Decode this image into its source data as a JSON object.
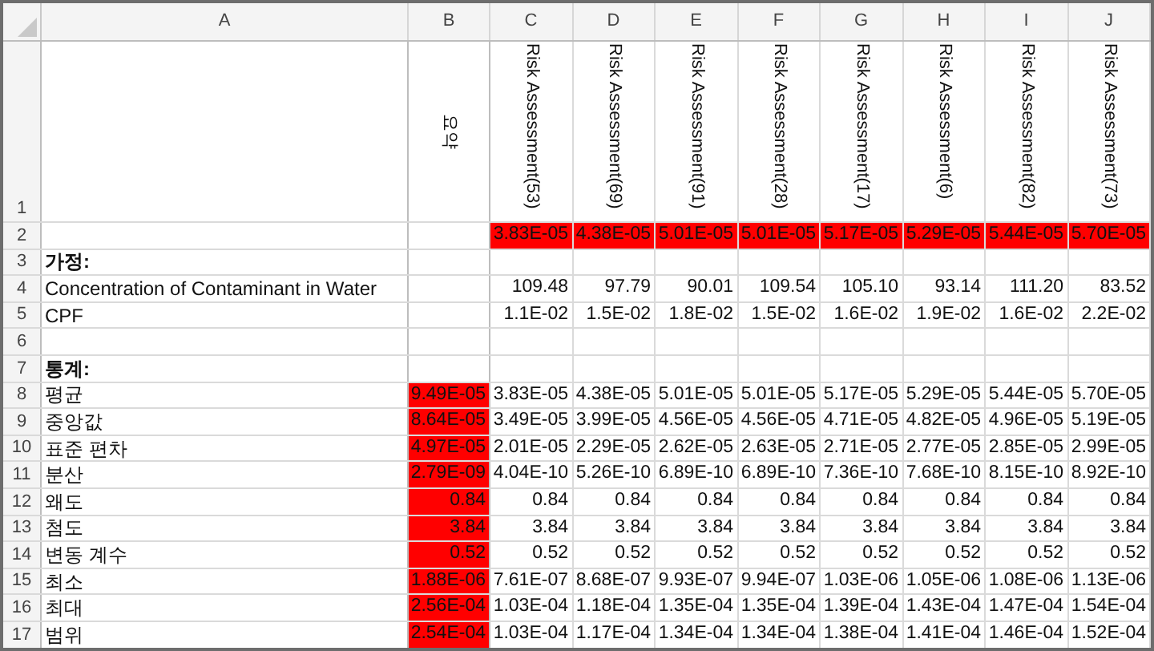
{
  "columns": [
    {
      "letter": "A"
    },
    {
      "letter": "B",
      "header": "요약"
    },
    {
      "letter": "C",
      "header": "Risk Assessment(53)"
    },
    {
      "letter": "D",
      "header": "Risk Assessment(69)"
    },
    {
      "letter": "E",
      "header": "Risk Assessment(91)"
    },
    {
      "letter": "F",
      "header": "Risk Assessment(28)"
    },
    {
      "letter": "G",
      "header": "Risk Assessment(17)"
    },
    {
      "letter": "H",
      "header": "Risk Assessment(6)"
    },
    {
      "letter": "I",
      "header": "Risk Assessment(82)"
    },
    {
      "letter": "J",
      "header": "Risk Assessment(73)"
    }
  ],
  "rows": [
    {
      "number": "1"
    },
    {
      "number": "2",
      "cells": [
        {
          "text": "3.83E-05",
          "highlighted": true
        },
        {
          "text": "4.38E-05",
          "highlighted": true
        },
        {
          "text": "5.01E-05",
          "highlighted": true
        },
        {
          "text": "5.01E-05",
          "highlighted": true
        },
        {
          "text": "5.17E-05",
          "highlighted": true
        },
        {
          "text": "5.29E-05",
          "highlighted": true
        },
        {
          "text": "5.44E-05",
          "highlighted": true
        },
        {
          "text": "5.70E-05",
          "highlighted": true
        }
      ]
    },
    {
      "number": "3",
      "label": "가정:",
      "bold": true
    },
    {
      "number": "4",
      "label": "Concentration of Contaminant in Water",
      "bold": false,
      "cells": [
        {
          "text": "109.48",
          "highlighted": false
        },
        {
          "text": "97.79",
          "highlighted": false
        },
        {
          "text": "90.01",
          "highlighted": false
        },
        {
          "text": "109.54",
          "highlighted": false
        },
        {
          "text": "105.10",
          "highlighted": false
        },
        {
          "text": "93.14",
          "highlighted": false
        },
        {
          "text": "111.20",
          "highlighted": false
        },
        {
          "text": "83.52",
          "highlighted": false
        }
      ]
    },
    {
      "number": "5",
      "label": "CPF",
      "bold": false,
      "cells": [
        {
          "text": "1.1E-02",
          "highlighted": false
        },
        {
          "text": "1.5E-02",
          "highlighted": false
        },
        {
          "text": "1.8E-02",
          "highlighted": false
        },
        {
          "text": "1.5E-02",
          "highlighted": false
        },
        {
          "text": "1.6E-02",
          "highlighted": false
        },
        {
          "text": "1.9E-02",
          "highlighted": false
        },
        {
          "text": "1.6E-02",
          "highlighted": false
        },
        {
          "text": "2.2E-02",
          "highlighted": false
        }
      ]
    },
    {
      "number": "6"
    },
    {
      "number": "7",
      "label": "통계:",
      "bold": true
    },
    {
      "number": "8",
      "label": "평균",
      "bold": false,
      "cells": [
        {
          "text": "9.49E-05",
          "highlighted": true
        },
        {
          "text": "3.83E-05",
          "highlighted": false
        },
        {
          "text": "4.38E-05",
          "highlighted": false
        },
        {
          "text": "5.01E-05",
          "highlighted": false
        },
        {
          "text": "5.01E-05",
          "highlighted": false
        },
        {
          "text": "5.17E-05",
          "highlighted": false
        },
        {
          "text": "5.29E-05",
          "highlighted": false
        },
        {
          "text": "5.44E-05",
          "highlighted": false
        },
        {
          "text": "5.70E-05",
          "highlighted": false
        }
      ]
    },
    {
      "number": "9",
      "label": "중앙값",
      "bold": false,
      "cells": [
        {
          "text": "8.64E-05",
          "highlighted": true
        },
        {
          "text": "3.49E-05",
          "highlighted": false
        },
        {
          "text": "3.99E-05",
          "highlighted": false
        },
        {
          "text": "4.56E-05",
          "highlighted": false
        },
        {
          "text": "4.56E-05",
          "highlighted": false
        },
        {
          "text": "4.71E-05",
          "highlighted": false
        },
        {
          "text": "4.82E-05",
          "highlighted": false
        },
        {
          "text": "4.96E-05",
          "highlighted": false
        },
        {
          "text": "5.19E-05",
          "highlighted": false
        }
      ]
    },
    {
      "number": "10",
      "label": "표준 편차",
      "bold": false,
      "cells": [
        {
          "text": "4.97E-05",
          "highlighted": true
        },
        {
          "text": "2.01E-05",
          "highlighted": false
        },
        {
          "text": "2.29E-05",
          "highlighted": false
        },
        {
          "text": "2.62E-05",
          "highlighted": false
        },
        {
          "text": "2.63E-05",
          "highlighted": false
        },
        {
          "text": "2.71E-05",
          "highlighted": false
        },
        {
          "text": "2.77E-05",
          "highlighted": false
        },
        {
          "text": "2.85E-05",
          "highlighted": false
        },
        {
          "text": "2.99E-05",
          "highlighted": false
        }
      ]
    },
    {
      "number": "11",
      "label": "분산",
      "bold": false,
      "cells": [
        {
          "text": "2.79E-09",
          "highlighted": true
        },
        {
          "text": "4.04E-10",
          "highlighted": false
        },
        {
          "text": "5.26E-10",
          "highlighted": false
        },
        {
          "text": "6.89E-10",
          "highlighted": false
        },
        {
          "text": "6.89E-10",
          "highlighted": false
        },
        {
          "text": "7.36E-10",
          "highlighted": false
        },
        {
          "text": "7.68E-10",
          "highlighted": false
        },
        {
          "text": "8.15E-10",
          "highlighted": false
        },
        {
          "text": "8.92E-10",
          "highlighted": false
        }
      ]
    },
    {
      "number": "12",
      "label": "왜도",
      "bold": false,
      "cells": [
        {
          "text": "0.84",
          "highlighted": true
        },
        {
          "text": "0.84",
          "highlighted": false
        },
        {
          "text": "0.84",
          "highlighted": false
        },
        {
          "text": "0.84",
          "highlighted": false
        },
        {
          "text": "0.84",
          "highlighted": false
        },
        {
          "text": "0.84",
          "highlighted": false
        },
        {
          "text": "0.84",
          "highlighted": false
        },
        {
          "text": "0.84",
          "highlighted": false
        },
        {
          "text": "0.84",
          "highlighted": false
        }
      ]
    },
    {
      "number": "13",
      "label": "첨도",
      "bold": false,
      "cells": [
        {
          "text": "3.84",
          "highlighted": true
        },
        {
          "text": "3.84",
          "highlighted": false
        },
        {
          "text": "3.84",
          "highlighted": false
        },
        {
          "text": "3.84",
          "highlighted": false
        },
        {
          "text": "3.84",
          "highlighted": false
        },
        {
          "text": "3.84",
          "highlighted": false
        },
        {
          "text": "3.84",
          "highlighted": false
        },
        {
          "text": "3.84",
          "highlighted": false
        },
        {
          "text": "3.84",
          "highlighted": false
        }
      ]
    },
    {
      "number": "14",
      "label": "변동 계수",
      "bold": false,
      "cells": [
        {
          "text": "0.52",
          "highlighted": true
        },
        {
          "text": "0.52",
          "highlighted": false
        },
        {
          "text": "0.52",
          "highlighted": false
        },
        {
          "text": "0.52",
          "highlighted": false
        },
        {
          "text": "0.52",
          "highlighted": false
        },
        {
          "text": "0.52",
          "highlighted": false
        },
        {
          "text": "0.52",
          "highlighted": false
        },
        {
          "text": "0.52",
          "highlighted": false
        },
        {
          "text": "0.52",
          "highlighted": false
        }
      ]
    },
    {
      "number": "15",
      "label": "최소",
      "bold": false,
      "cells": [
        {
          "text": "1.88E-06",
          "highlighted": true
        },
        {
          "text": "7.61E-07",
          "highlighted": false
        },
        {
          "text": "8.68E-07",
          "highlighted": false
        },
        {
          "text": "9.93E-07",
          "highlighted": false
        },
        {
          "text": "9.94E-07",
          "highlighted": false
        },
        {
          "text": "1.03E-06",
          "highlighted": false
        },
        {
          "text": "1.05E-06",
          "highlighted": false
        },
        {
          "text": "1.08E-06",
          "highlighted": false
        },
        {
          "text": "1.13E-06",
          "highlighted": false
        }
      ]
    },
    {
      "number": "16",
      "label": "최대",
      "bold": false,
      "cells": [
        {
          "text": "2.56E-04",
          "highlighted": true
        },
        {
          "text": "1.03E-04",
          "highlighted": false
        },
        {
          "text": "1.18E-04",
          "highlighted": false
        },
        {
          "text": "1.35E-04",
          "highlighted": false
        },
        {
          "text": "1.35E-04",
          "highlighted": false
        },
        {
          "text": "1.39E-04",
          "highlighted": false
        },
        {
          "text": "1.43E-04",
          "highlighted": false
        },
        {
          "text": "1.47E-04",
          "highlighted": false
        },
        {
          "text": "1.54E-04",
          "highlighted": false
        }
      ]
    },
    {
      "number": "17",
      "label": "범위",
      "bold": false,
      "cells": [
        {
          "text": "2.54E-04",
          "highlighted": true
        },
        {
          "text": "1.03E-04",
          "highlighted": false
        },
        {
          "text": "1.17E-04",
          "highlighted": false
        },
        {
          "text": "1.34E-04",
          "highlighted": false
        },
        {
          "text": "1.34E-04",
          "highlighted": false
        },
        {
          "text": "1.38E-04",
          "highlighted": false
        },
        {
          "text": "1.41E-04",
          "highlighted": false
        },
        {
          "text": "1.46E-04",
          "highlighted": false
        },
        {
          "text": "1.52E-04",
          "highlighted": false
        }
      ]
    }
  ]
}
